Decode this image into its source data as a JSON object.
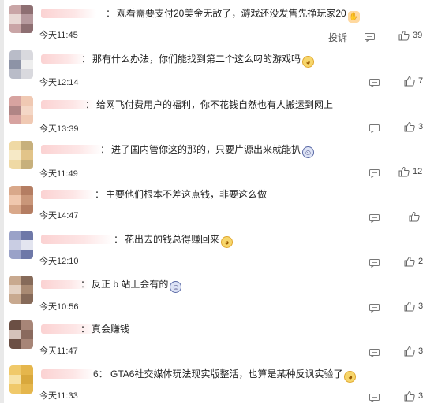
{
  "report_label": "投诉",
  "comments": [
    {
      "text": "观看需要支付20美金无敌了，游戏还没发售先挣玩家20",
      "emoji": "thumb",
      "time": "今天11:45",
      "likes": "39",
      "name_suffix": "：",
      "show_report": true
    },
    {
      "text": "那有什么办法，你们能找到第二个这么叼的游戏吗",
      "emoji": "cat",
      "time": "今天12:14",
      "likes": "7",
      "name_suffix": "：",
      "show_report": false
    },
    {
      "text": "给网飞付费用户的福利，你不花钱自然也有人搬运到网上",
      "emoji": "",
      "time": "今天13:39",
      "likes": "3",
      "name_suffix": "：",
      "show_report": false
    },
    {
      "text": "进了国内管你这的那的，只要片源出来就能扒",
      "emoji": "blue",
      "time": "今天11:49",
      "likes": "12",
      "name_suffix": "：",
      "show_report": false
    },
    {
      "text": "主要他们根本不差这点钱，非要这么做",
      "emoji": "",
      "time": "今天14:47",
      "likes": "",
      "name_suffix": "：",
      "show_report": false
    },
    {
      "text": "花出去的钱总得赚回来",
      "emoji": "cat",
      "time": "今天12:10",
      "likes": "2",
      "name_suffix": "：",
      "show_report": false
    },
    {
      "text": "反正 b 站上会有的",
      "emoji": "blue",
      "time": "今天10:56",
      "likes": "3",
      "name_suffix": "：",
      "show_report": false
    },
    {
      "text": "真会赚钱",
      "emoji": "",
      "time": "今天11:47",
      "likes": "3",
      "name_suffix": "：",
      "show_report": false
    },
    {
      "text": "GTA6社交媒体玩法现实版整活，也算是某种反讽实验了",
      "emoji": "cat",
      "time": "今天11:33",
      "likes": "3",
      "name_suffix": "6：",
      "show_report": false
    }
  ],
  "icons": {
    "comment": "comment-icon",
    "like": "thumbs-up-icon",
    "emoji_cat": "cat-emoji-icon",
    "emoji_blue": "blue-face-emoji-icon",
    "emoji_thumb": "thumb-emoji-icon"
  },
  "colors": {
    "name_blur": "#fbd2d2",
    "text": "#222222",
    "icon": "#777777"
  }
}
